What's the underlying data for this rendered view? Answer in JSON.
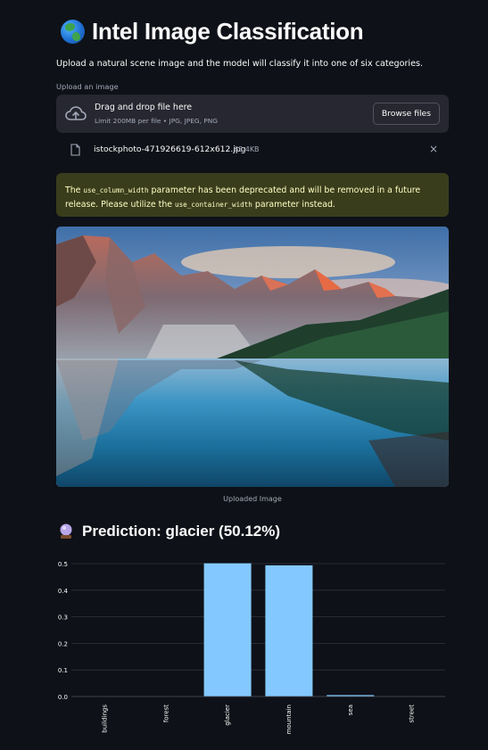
{
  "header": {
    "title": "Intel Image Classification",
    "icon": "globe-icon",
    "subtitle": "Upload a natural scene image and the model will classify it into one of six categories."
  },
  "uploader": {
    "label": "Upload an image",
    "drop_text": "Drag and drop file here",
    "limit_text": "Limit 200MB per file • JPG, JPEG, PNG",
    "browse_label": "Browse files"
  },
  "file": {
    "name": "istockphoto-471926619-612x612.jpg",
    "size": "63.4KB",
    "close": "×"
  },
  "warning": {
    "part1": "The ",
    "code1": "use_column_width",
    "part2": " parameter has been deprecated and will be removed in a future release. Please utilize the ",
    "code2": "use_container_width",
    "part3": " parameter instead."
  },
  "image": {
    "caption": "Uploaded Image"
  },
  "prediction": {
    "text": "Prediction: glacier (50.12%)",
    "icon": "crystal-ball-icon"
  },
  "colors": {
    "background": "#0e1117",
    "bar": "#83c9ff",
    "warning_bg": "#3a3d1c",
    "warning_text": "#ffffc2"
  },
  "chart_data": {
    "type": "bar",
    "categories": [
      "buildings",
      "forest",
      "glacier",
      "mountain",
      "sea",
      "street"
    ],
    "values": [
      0.0,
      0.0,
      0.5012,
      0.4935,
      0.0053,
      0.0
    ],
    "yticks": [
      "0.0",
      "0.1",
      "0.2",
      "0.3",
      "0.4",
      "0.5"
    ],
    "ylim": [
      0,
      0.5
    ],
    "grid": true,
    "title": "",
    "xlabel": "",
    "ylabel": ""
  }
}
